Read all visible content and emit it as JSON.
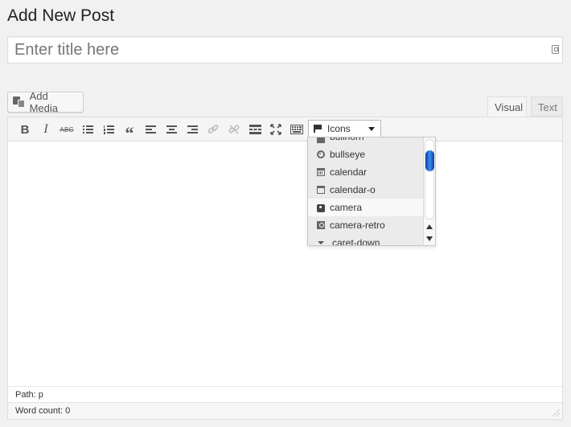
{
  "page": {
    "title": "Add New Post"
  },
  "title_field": {
    "placeholder": "Enter title here",
    "value": ""
  },
  "media": {
    "add_media_label": "Add Media"
  },
  "tabs": {
    "visual": "Visual",
    "text": "Text"
  },
  "toolbar": {
    "bold": "B",
    "italic": "I",
    "strikethrough": "ABC",
    "quote": "“",
    "icons_select_label": "Icons",
    "buttons": [
      "bold-button",
      "italic-button",
      "strikethrough-button",
      "bullet-list-button",
      "numbered-list-button",
      "blockquote-button",
      "align-left-button",
      "align-center-button",
      "align-right-button",
      "insert-link-button",
      "unlink-button",
      "read-more-button",
      "fullscreen-button",
      "toolbar-toggle-button"
    ]
  },
  "icons_dropdown": {
    "items": [
      {
        "label": "bullhorn",
        "icon": "bullhorn-icon"
      },
      {
        "label": "bullseye",
        "icon": "bullseye-icon"
      },
      {
        "label": "calendar",
        "icon": "calendar-icon"
      },
      {
        "label": "calendar-o",
        "icon": "calendar-o-icon"
      },
      {
        "label": "camera",
        "icon": "camera-icon",
        "hovered": true
      },
      {
        "label": "camera-retro",
        "icon": "camera-retro-icon"
      },
      {
        "label": "caret-down",
        "icon": "caret-down-icon"
      }
    ]
  },
  "status": {
    "path": "Path: p",
    "word_count": "Word count: 0"
  }
}
